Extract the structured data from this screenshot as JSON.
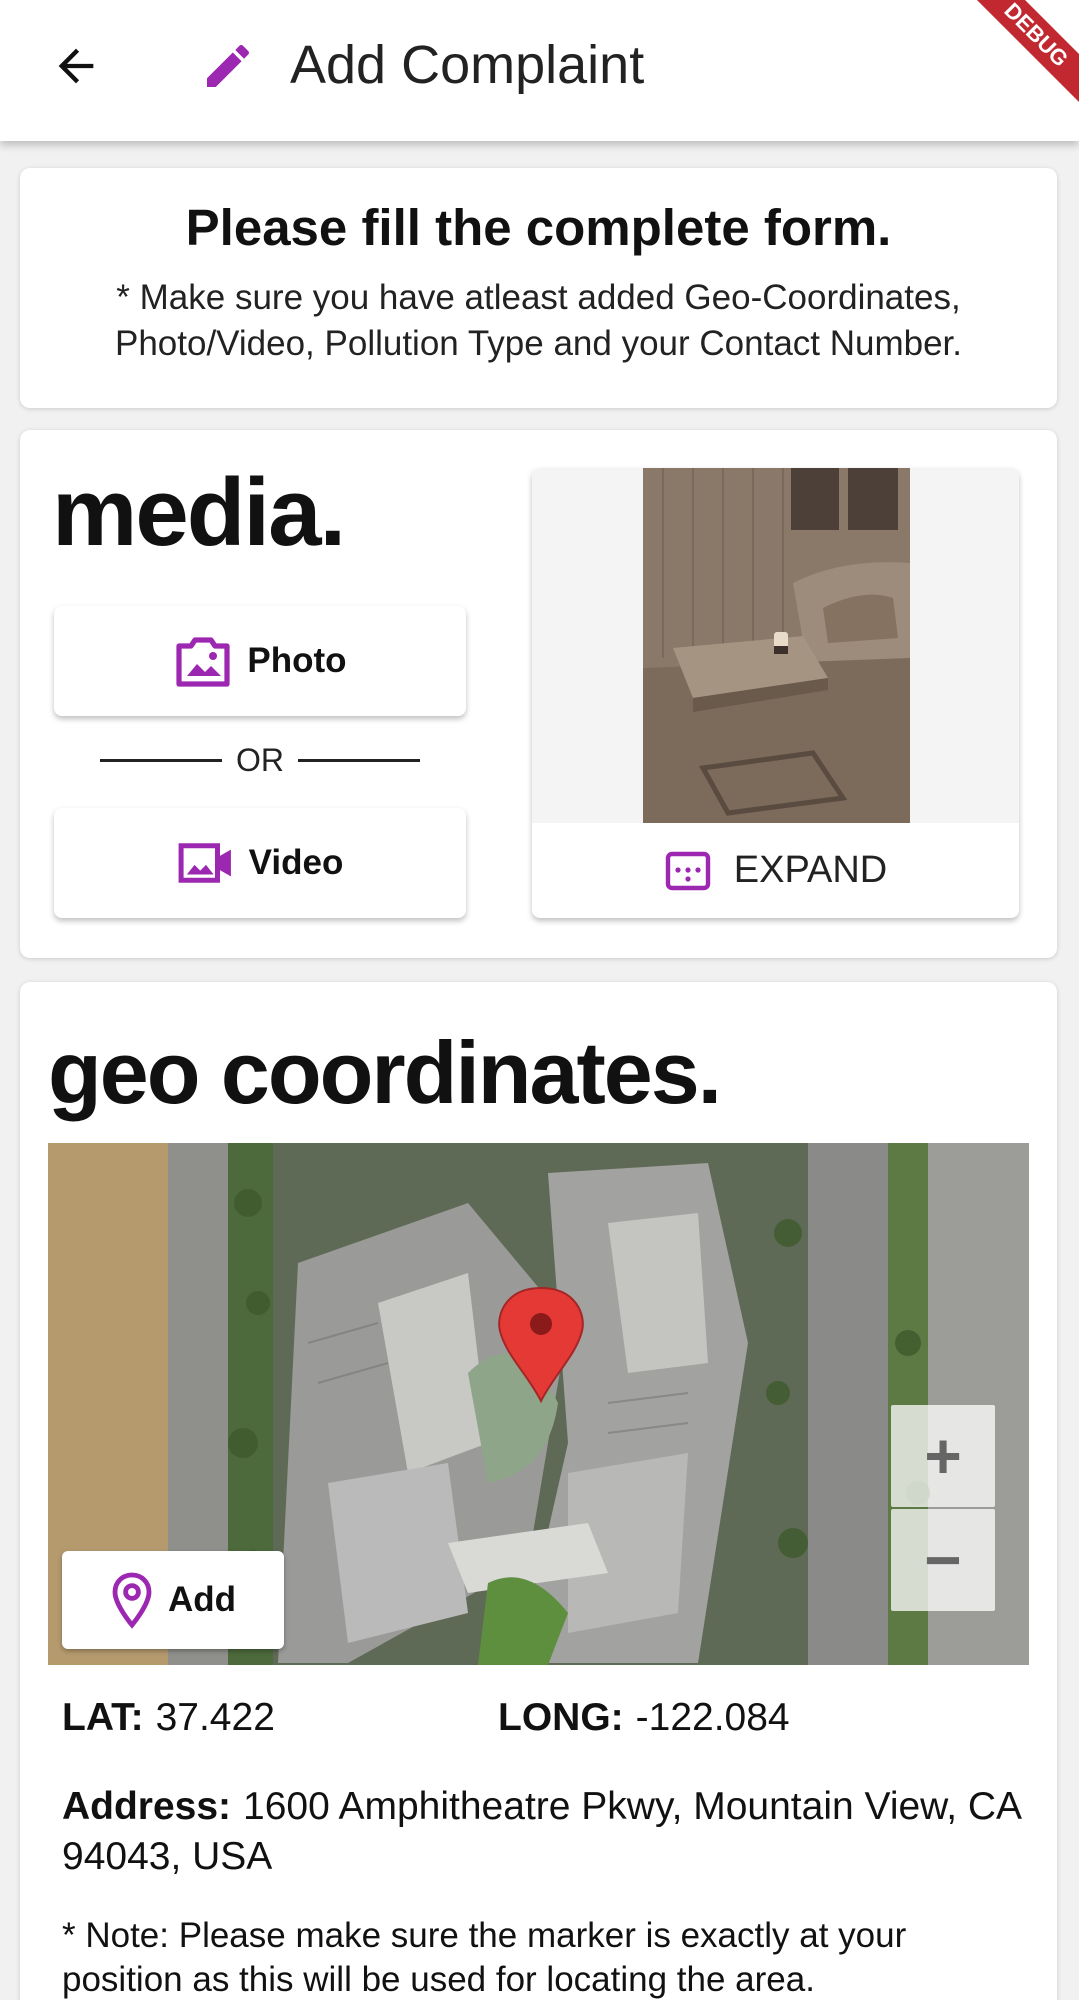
{
  "appbar": {
    "title": "Add Complaint",
    "back_icon": "arrow-left-icon",
    "title_icon": "pencil-icon",
    "debug_banner": "DEBUG",
    "accent": "#9c27b0"
  },
  "intro": {
    "heading": "Please fill the complete form.",
    "note": "* Make sure you have atleast added Geo-Coordinates, Photo/Video, Pollution Type and your Contact Number."
  },
  "media": {
    "title": "media.",
    "photo_label": "Photo",
    "or_label": "OR",
    "video_label": "Video",
    "expand_label": "EXPAND"
  },
  "geo": {
    "title": "geo coordinates.",
    "add_label": "Add",
    "zoom_in": "+",
    "zoom_out": "−",
    "lat_label": "LAT:",
    "lat_value": "37.422",
    "long_label": "LONG:",
    "long_value": "-122.084",
    "address_label": "Address:",
    "address_value": "1600 Amphitheatre Pkwy, Mountain View, CA 94043, USA",
    "note": "* Note: Please make sure the marker is exactly at your position as this will be used for locating the area."
  }
}
